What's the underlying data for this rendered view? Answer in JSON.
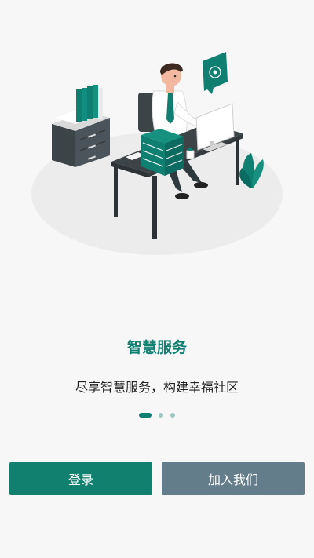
{
  "onboarding": {
    "title": "智慧服务",
    "subtitle": "尽享智慧服务，构建幸福社区",
    "page_indicator": {
      "count": 3,
      "active": 1
    }
  },
  "actions": {
    "login_label": "登录",
    "join_label": "加入我们"
  },
  "colors": {
    "accent": "#0f7f72",
    "secondary_button": "#637d8a",
    "background": "#f7f7f7"
  }
}
